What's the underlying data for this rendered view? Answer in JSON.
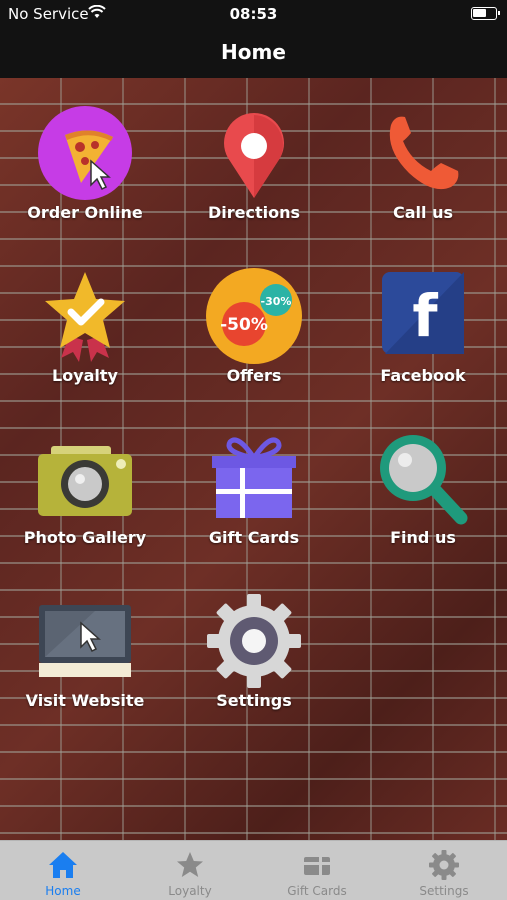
{
  "status_bar": {
    "carrier": "No Service",
    "time": "08:53"
  },
  "nav": {
    "title": "Home"
  },
  "tiles": [
    {
      "label": "Order Online",
      "icon": "pizza-icon"
    },
    {
      "label": "Directions",
      "icon": "map-pin-icon"
    },
    {
      "label": "Call us",
      "icon": "phone-icon"
    },
    {
      "label": "Loyalty",
      "icon": "star-badge-icon"
    },
    {
      "label": "Offers",
      "icon": "discount-icon",
      "badge_large": "-50%",
      "badge_small": "-30%"
    },
    {
      "label": "Facebook",
      "icon": "facebook-icon",
      "glyph": "f"
    },
    {
      "label": "Photo Gallery",
      "icon": "camera-icon"
    },
    {
      "label": "Gift Cards",
      "icon": "gift-icon"
    },
    {
      "label": "Find us",
      "icon": "magnifier-icon"
    },
    {
      "label": "Visit Website",
      "icon": "monitor-icon"
    },
    {
      "label": "Settings",
      "icon": "gear-icon"
    }
  ],
  "tab_bar": {
    "items": [
      {
        "label": "Home",
        "icon": "home-icon",
        "active": true
      },
      {
        "label": "Loyalty",
        "icon": "star-icon",
        "active": false
      },
      {
        "label": "Gift Cards",
        "icon": "gift-card-icon",
        "active": false
      },
      {
        "label": "Settings",
        "icon": "gear-icon",
        "active": false
      }
    ]
  },
  "colors": {
    "accent": "#1a7ef0",
    "bar_background": "#121212",
    "tab_bar_background": "#c9c9c9",
    "brick": "#6a2c24"
  }
}
